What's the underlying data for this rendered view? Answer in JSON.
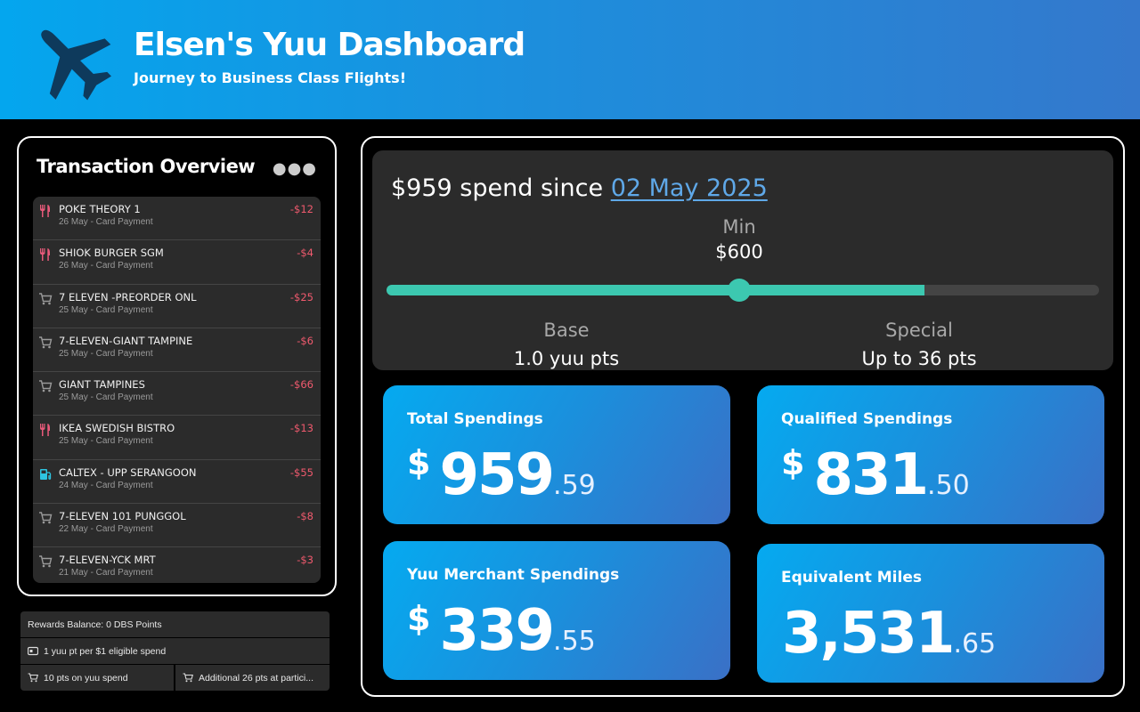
{
  "header": {
    "title": "Elsen's Yuu Dashboard",
    "subtitle": "Journey to Business Class Flights!",
    "icon": "airplane-icon"
  },
  "transactions": {
    "title": "Transaction Overview",
    "more_icon": "more-icon",
    "items": [
      {
        "name": "POKE THEORY 1",
        "meta": "26 May - Card Payment",
        "amount": "-$12",
        "icon": "food-icon"
      },
      {
        "name": "SHIOK BURGER SGM",
        "meta": "26 May - Card Payment",
        "amount": "-$4",
        "icon": "food-icon"
      },
      {
        "name": "7 ELEVEN -PREORDER ONL",
        "meta": "25 May - Card Payment",
        "amount": "-$25",
        "icon": "cart-icon"
      },
      {
        "name": "7-ELEVEN-GIANT TAMPINE",
        "meta": "25 May - Card Payment",
        "amount": "-$6",
        "icon": "cart-icon"
      },
      {
        "name": "GIANT TAMPINES",
        "meta": "25 May - Card Payment",
        "amount": "-$66",
        "icon": "cart-icon"
      },
      {
        "name": "IKEA SWEDISH BISTRO",
        "meta": "25 May - Card Payment",
        "amount": "-$13",
        "icon": "food-icon"
      },
      {
        "name": "CALTEX - UPP SERANGOON",
        "meta": "24 May - Card Payment",
        "amount": "-$55",
        "icon": "fuel-icon"
      },
      {
        "name": "7-ELEVEN 101 PUNGGOL",
        "meta": "22 May - Card Payment",
        "amount": "-$8",
        "icon": "cart-icon"
      },
      {
        "name": "7-ELEVEN-YCK MRT",
        "meta": "21 May - Card Payment",
        "amount": "-$3",
        "icon": "cart-icon"
      }
    ]
  },
  "rewards": {
    "balance": "Rewards Balance: 0 DBS Points",
    "rate": "1 yuu pt per $1 eligible spend",
    "yuu_spend": "10 pts on yuu spend",
    "additional": "Additional 26 pts at partici..."
  },
  "spend_tracker": {
    "prefix": "$959 spend since",
    "date": "02 May 2025",
    "min_label": "Min",
    "min_value": "$600",
    "progress_fraction": 0.755,
    "min_fraction": 0.495,
    "base_label": "Base",
    "base_value": "1.0 yuu pts",
    "special_label": "Special",
    "special_value": "Up to 36 pts"
  },
  "stats": {
    "total": {
      "label": "Total Spendings",
      "currency": "$",
      "int": "959",
      "dec": ".59"
    },
    "qualified": {
      "label": "Qualified Spendings",
      "currency": "$",
      "int": "831",
      "dec": ".50"
    },
    "merchant": {
      "label": "Yuu Merchant Spendings",
      "currency": "$",
      "int": "339",
      "dec": ".55"
    },
    "miles": {
      "label": "Equivalent Miles",
      "int": "3,531",
      "dec": ".65"
    }
  },
  "colors": {
    "accent_teal": "#3cc8b0",
    "negative_amount": "#f05a6e",
    "link_blue": "#5fa8e8",
    "header_blue": "#04a6ee"
  }
}
